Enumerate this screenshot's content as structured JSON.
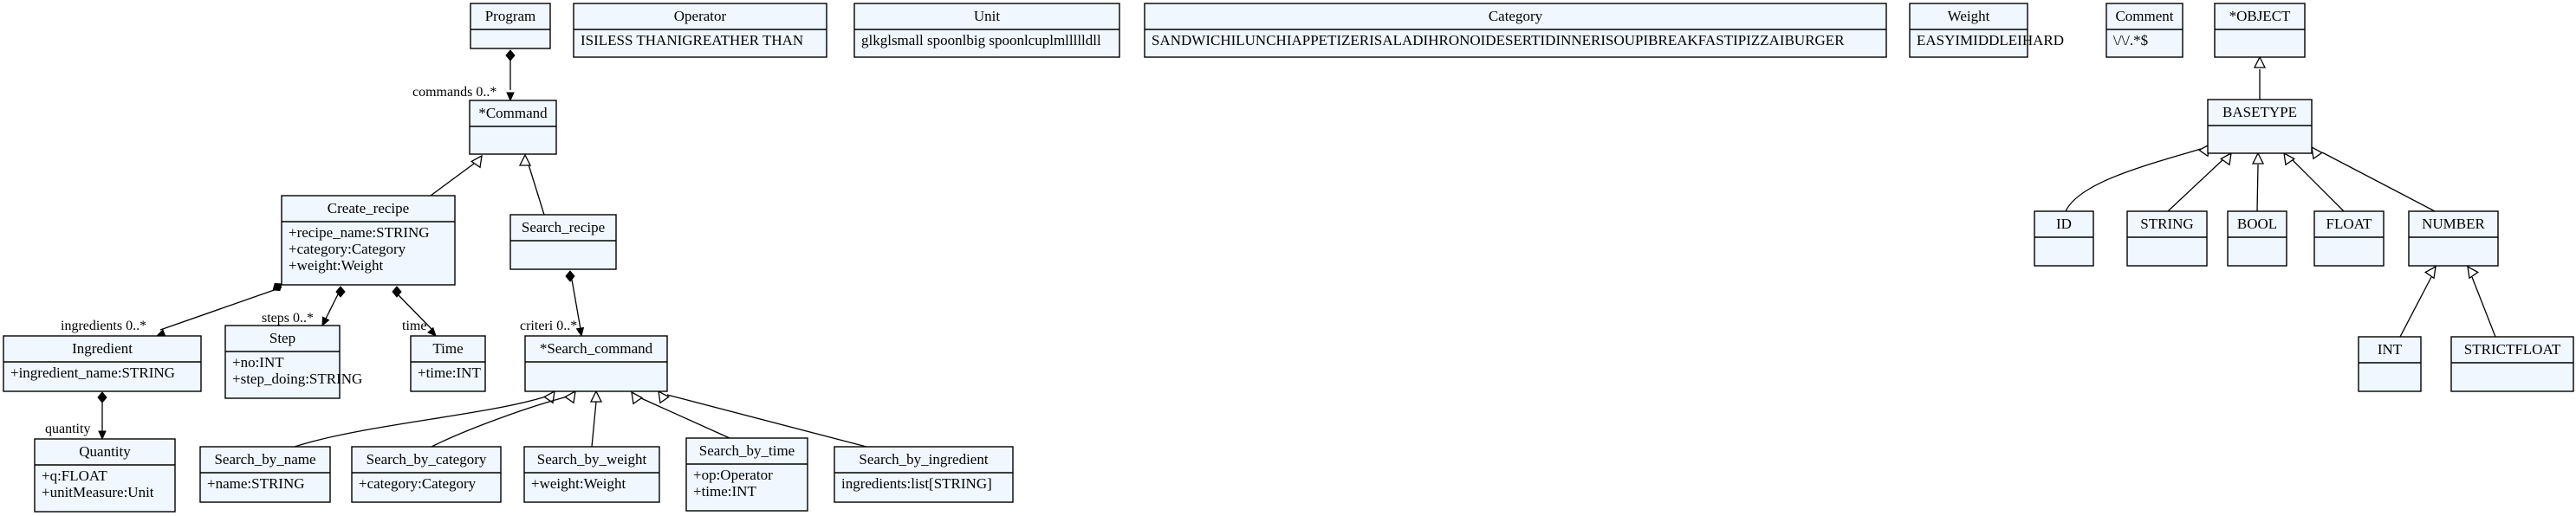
{
  "classes": {
    "program": {
      "name": "Program",
      "attrs": []
    },
    "operator": {
      "name": "Operator",
      "attrs": [
        "ISILESS THANIGREATHER THAN"
      ]
    },
    "unit": {
      "name": "Unit",
      "attrs": [
        "glkglsmall spoonlbig spoonlcuplmllllldll"
      ]
    },
    "category": {
      "name": "Category",
      "attrs": [
        "SANDWICHILUNCHIAPPETIZERISALADIHRONOIDESERTIDINNERISOUPIBREAKFASTIPIZZAIBURGER"
      ]
    },
    "weight": {
      "name": "Weight",
      "attrs": [
        "EASYIMIDDLEIHARD"
      ]
    },
    "comment": {
      "name": "Comment",
      "attrs": [
        "\\/\\/.*$"
      ]
    },
    "object": {
      "name": "*OBJECT",
      "attrs": []
    },
    "command": {
      "name": "*Command",
      "attrs": []
    },
    "basetype": {
      "name": "BASETYPE",
      "attrs": []
    },
    "create_recipe": {
      "name": "Create_recipe",
      "attrs": [
        "+recipe_name:STRING",
        "+category:Category",
        "+weight:Weight"
      ]
    },
    "search_recipe": {
      "name": "Search_recipe",
      "attrs": []
    },
    "id": {
      "name": "ID",
      "attrs": []
    },
    "string": {
      "name": "STRING",
      "attrs": []
    },
    "bool": {
      "name": "BOOL",
      "attrs": []
    },
    "float": {
      "name": "FLOAT",
      "attrs": []
    },
    "number": {
      "name": "NUMBER",
      "attrs": []
    },
    "ingredient": {
      "name": "Ingredient",
      "attrs": [
        "+ingredient_name:STRING"
      ]
    },
    "step": {
      "name": "Step",
      "attrs": [
        "+no:INT",
        "+step_doing:STRING"
      ]
    },
    "time": {
      "name": "Time",
      "attrs": [
        "+time:INT"
      ]
    },
    "search_command": {
      "name": "*Search_command",
      "attrs": []
    },
    "int": {
      "name": "INT",
      "attrs": []
    },
    "strictfloat": {
      "name": "STRICTFLOAT",
      "attrs": []
    },
    "quantity": {
      "name": "Quantity",
      "attrs": [
        "+q:FLOAT",
        "+unitMeasure:Unit"
      ]
    },
    "search_by_name": {
      "name": "Search_by_name",
      "attrs": [
        "+name:STRING"
      ]
    },
    "search_by_category": {
      "name": "Search_by_category",
      "attrs": [
        "+category:Category"
      ]
    },
    "search_by_weight": {
      "name": "Search_by_weight",
      "attrs": [
        "+weight:Weight"
      ]
    },
    "search_by_time": {
      "name": "Search_by_time",
      "attrs": [
        "+op:Operator",
        "+time:INT"
      ]
    },
    "search_by_ingredient": {
      "name": "Search_by_ingredient",
      "attrs": [
        "ingredients:list[STRING]"
      ]
    }
  },
  "edges": [
    {
      "from": "program",
      "to": "command",
      "kind": "composition",
      "label": "commands 0..*"
    },
    {
      "from": "create_recipe",
      "to": "command",
      "kind": "inheritance"
    },
    {
      "from": "search_recipe",
      "to": "command",
      "kind": "inheritance"
    },
    {
      "from": "create_recipe",
      "to": "ingredient",
      "kind": "composition",
      "label": "ingredients 0..*"
    },
    {
      "from": "create_recipe",
      "to": "step",
      "kind": "composition",
      "label": "steps 0..*"
    },
    {
      "from": "create_recipe",
      "to": "time",
      "kind": "composition",
      "label": "time"
    },
    {
      "from": "search_recipe",
      "to": "search_command",
      "kind": "composition",
      "label": "criteri 0..*"
    },
    {
      "from": "ingredient",
      "to": "quantity",
      "kind": "composition",
      "label": "quantity"
    },
    {
      "from": "search_by_name",
      "to": "search_command",
      "kind": "inheritance"
    },
    {
      "from": "search_by_category",
      "to": "search_command",
      "kind": "inheritance"
    },
    {
      "from": "search_by_weight",
      "to": "search_command",
      "kind": "inheritance"
    },
    {
      "from": "search_by_time",
      "to": "search_command",
      "kind": "inheritance"
    },
    {
      "from": "search_by_ingredient",
      "to": "search_command",
      "kind": "inheritance"
    },
    {
      "from": "basetype",
      "to": "object",
      "kind": "inheritance"
    },
    {
      "from": "id",
      "to": "basetype",
      "kind": "inheritance"
    },
    {
      "from": "string",
      "to": "basetype",
      "kind": "inheritance"
    },
    {
      "from": "bool",
      "to": "basetype",
      "kind": "inheritance"
    },
    {
      "from": "float",
      "to": "basetype",
      "kind": "inheritance"
    },
    {
      "from": "number",
      "to": "basetype",
      "kind": "inheritance"
    },
    {
      "from": "int",
      "to": "number",
      "kind": "inheritance"
    },
    {
      "from": "strictfloat",
      "to": "number",
      "kind": "inheritance"
    }
  ]
}
